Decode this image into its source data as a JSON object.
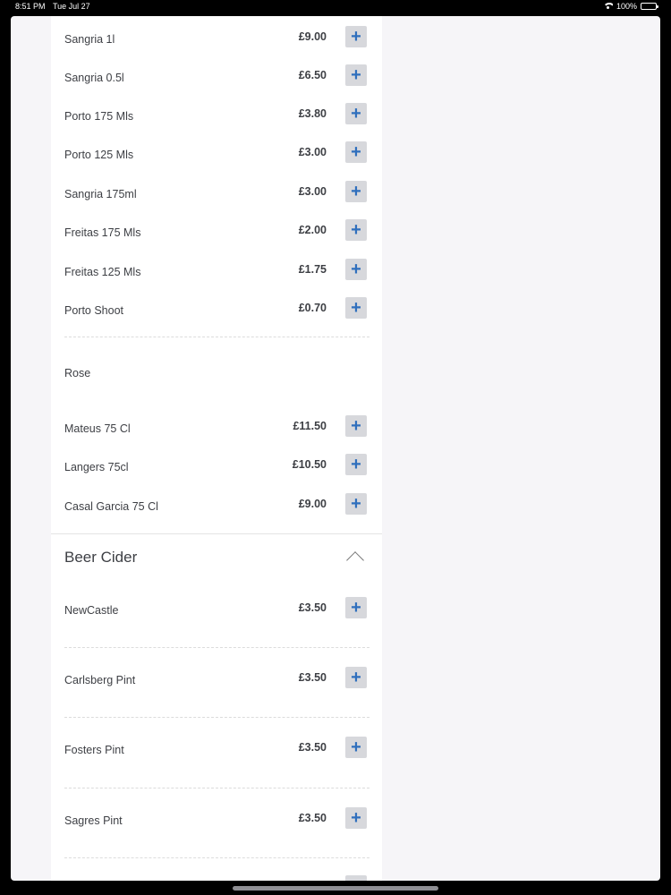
{
  "status_bar": {
    "time": "8:51 PM",
    "date": "Tue Jul 27",
    "battery": "100%"
  },
  "wine_items": [
    {
      "name": "Sangria 1l",
      "price": "£9.00"
    },
    {
      "name": "Sangria 0.5l",
      "price": "£6.50"
    },
    {
      "name": "Porto 175 Mls",
      "price": "£3.80"
    },
    {
      "name": "Porto 125 Mls",
      "price": "£3.00"
    },
    {
      "name": "Sangria 175ml",
      "price": "£3.00"
    },
    {
      "name": "Freitas 175 Mls",
      "price": "£2.00"
    },
    {
      "name": "Freitas 125 Mls",
      "price": "£1.75"
    },
    {
      "name": "Porto Shoot",
      "price": "£0.70"
    }
  ],
  "rose": {
    "heading": "Rose",
    "items": [
      {
        "name": "Mateus 75 Cl",
        "price": "£11.50"
      },
      {
        "name": "Langers 75cl",
        "price": "£10.50"
      },
      {
        "name": "Casal Garcia 75 Cl",
        "price": "£9.00"
      }
    ]
  },
  "beer_cider": {
    "title": "Beer Cider",
    "items": [
      {
        "name": "NewCastle",
        "price": "£3.50"
      },
      {
        "name": "Carlsberg Pint",
        "price": "£3.50"
      },
      {
        "name": "Fosters Pint",
        "price": "£3.50"
      },
      {
        "name": "Sagres Pint",
        "price": "£3.50"
      }
    ]
  },
  "add_label": "+",
  "colors": {
    "accent": "#2f6fbd",
    "button_bg": "#d7d8dc",
    "text": "#3d3f44",
    "background": "#f6f5f8"
  }
}
